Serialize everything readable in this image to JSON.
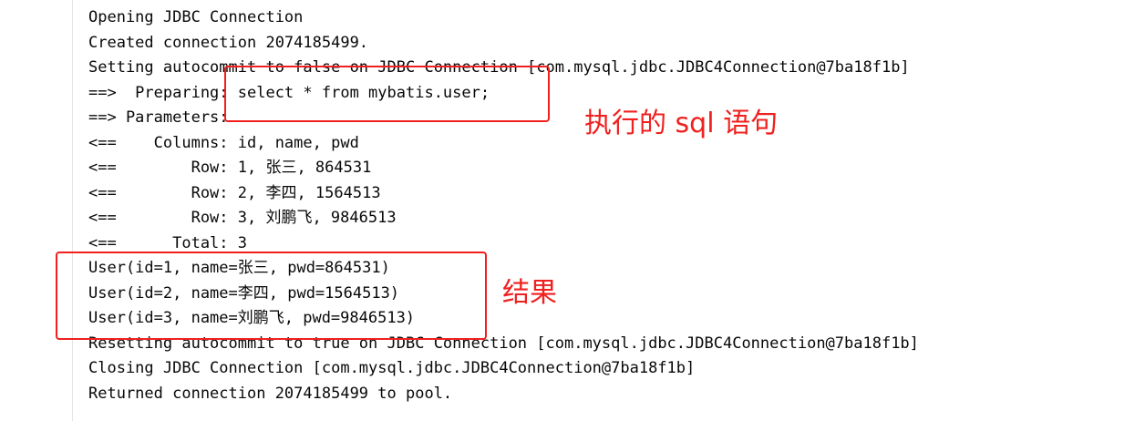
{
  "console": {
    "lines": [
      "Opening JDBC Connection",
      "Created connection 2074185499.",
      "Setting autocommit to false on JDBC Connection [com.mysql.jdbc.JDBC4Connection@7ba18f1b]",
      "==>  Preparing: select * from mybatis.user;",
      "==> Parameters: ",
      "<==    Columns: id, name, pwd",
      "<==        Row: 1, 张三, 864531",
      "<==        Row: 2, 李四, 1564513",
      "<==        Row: 3, 刘鹏飞, 9846513",
      "<==      Total: 3",
      "User(id=1, name=张三, pwd=864531)",
      "User(id=2, name=李四, pwd=1564513)",
      "User(id=3, name=刘鹏飞, pwd=9846513)",
      "Resetting autocommit to true on JDBC Connection [com.mysql.jdbc.JDBC4Connection@7ba18f1b]",
      "Closing JDBC Connection [com.mysql.jdbc.JDBC4Connection@7ba18f1b]",
      "Returned connection 2074185499 to pool."
    ]
  },
  "annotations": {
    "sql_label": "执行的 sql 语句",
    "result_label": "结果",
    "color": "#f0201f"
  }
}
